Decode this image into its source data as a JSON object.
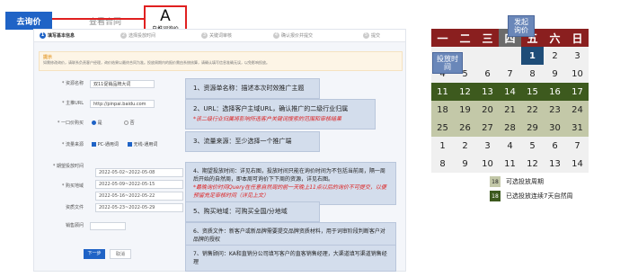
{
  "tabs": {
    "inquiry": "去询价",
    "contract": "查看合同"
  },
  "callout": {
    "letter": "A",
    "text": "自推词询价"
  },
  "steps": [
    {
      "num": "1",
      "label": "填写基本信息"
    },
    {
      "num": "2",
      "label": "选择投放时间"
    },
    {
      "num": "3",
      "label": "关键词审核"
    },
    {
      "num": "4",
      "label": "确认报价并提交"
    },
    {
      "num": "5",
      "label": "提交"
    }
  ],
  "notice": {
    "title": "提示",
    "body": "如需修改询价，请联系负责客户经理，询价结果以最终合同为准。投放周期内的报价需由系统核算，请确认填写信息准确无误，以免影响投放。"
  },
  "form": {
    "name_label": "* 资源名称",
    "name_value": "双11促销品牌大词",
    "url_label": "* 主推URL",
    "url_value": "http://pinpai.baidu.com",
    "flow_label": "* 一口价购买",
    "flow_yes": "是",
    "flow_no": "否",
    "source_label": "* 流量来源",
    "source_opt1": "PC-通用词",
    "source_opt2": "无线-通用词",
    "time_label": "* 期望投放时间",
    "region_label": "* 购买地域",
    "file_label": "资质文件",
    "sales_label": "销售顾问",
    "dates": [
      "2022-05-02~2022-05-08",
      "2022-05-09~2022-05-15",
      "2022-05-16~2022-05-22",
      "2022-05-23~2022-05-29"
    ],
    "next": "下一步",
    "cancel": "取消"
  },
  "annotations": {
    "a1": "1、资源单名称：描述本次时效推广主题",
    "a2": "2、URL：选择客户主域URL，确认推广的二级行业归属",
    "a2_note": "*该二级行业归属将影响所选客户关键词搜索的范围和审核结果",
    "a3": "3、流量来源：至少选择一个推广端",
    "a4": "4、期望投放时间：详见右图，投放时间只能在询价时间为不包括当前周，隔一周后开始的自然周，即本周可询价下下周的资源，详见右图。",
    "a4_note": "*最晚询价时间Query在任意自然周的前一天晚上11点以后的询价不可提交，以便预留充足审核时间（详见上文）",
    "a5": "5、购买地域：可购买全国/分地域",
    "a6": "6、资质文件：新客户或新品牌需要提交品牌资质材料，用于词审阶段判断客户对品牌的授权",
    "a7": "7、销售顾问：KA和直销分公司填写客户的直客销售经理，大渠道填写渠道销售经理"
  },
  "calendar": {
    "headers": [
      "一",
      "二",
      "三",
      "四",
      "五",
      "六",
      "日"
    ],
    "rows": [
      [
        "",
        "",
        "",
        "",
        "1",
        "2",
        "3"
      ],
      [
        "4",
        "5",
        "6",
        "7",
        "8",
        "9",
        "10"
      ],
      [
        "11",
        "12",
        "13",
        "14",
        "15",
        "16",
        "17"
      ],
      [
        "18",
        "19",
        "20",
        "21",
        "22",
        "23",
        "24"
      ],
      [
        "25",
        "26",
        "27",
        "28",
        "29",
        "30",
        "31"
      ],
      [
        "1",
        "2",
        "3",
        "4",
        "5",
        "6",
        "7"
      ],
      [
        "8",
        "9",
        "10",
        "11",
        "12",
        "13",
        "14"
      ]
    ],
    "bubble_inquiry": "发起询价",
    "bubble_launch": "投放时间"
  },
  "legend": {
    "item1_num": "18",
    "item1_text": "可选投放周期",
    "item2_num": "18",
    "item2_text": "已选投放连续7天自然周"
  },
  "colors": {
    "primary": "#1f63c6",
    "accent_red": "#e02020",
    "cal_head": "#8a1f1f",
    "green": "#3d5a1e"
  }
}
